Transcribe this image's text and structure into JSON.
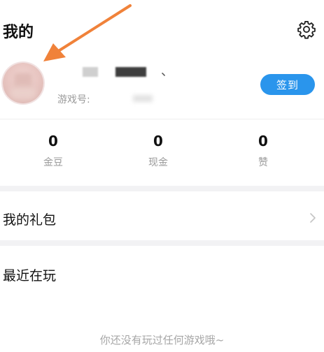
{
  "header": {
    "title": "我的",
    "settings_icon": "gear-icon"
  },
  "profile": {
    "name_suffix": "、",
    "game_id_label": "游戏号:",
    "signin_label": "签到",
    "signin_color": "#2a95ec"
  },
  "stats": [
    {
      "value": "0",
      "label": "金豆"
    },
    {
      "value": "0",
      "label": "现金"
    },
    {
      "value": "0",
      "label": "赞"
    }
  ],
  "gift": {
    "label": "我的礼包",
    "chevron_icon": "chevron-right-icon"
  },
  "recent": {
    "title": "最近在玩",
    "empty_text": "你还没有玩过任何游戏哦~"
  },
  "annotation": {
    "arrow_color": "#f0823a"
  }
}
